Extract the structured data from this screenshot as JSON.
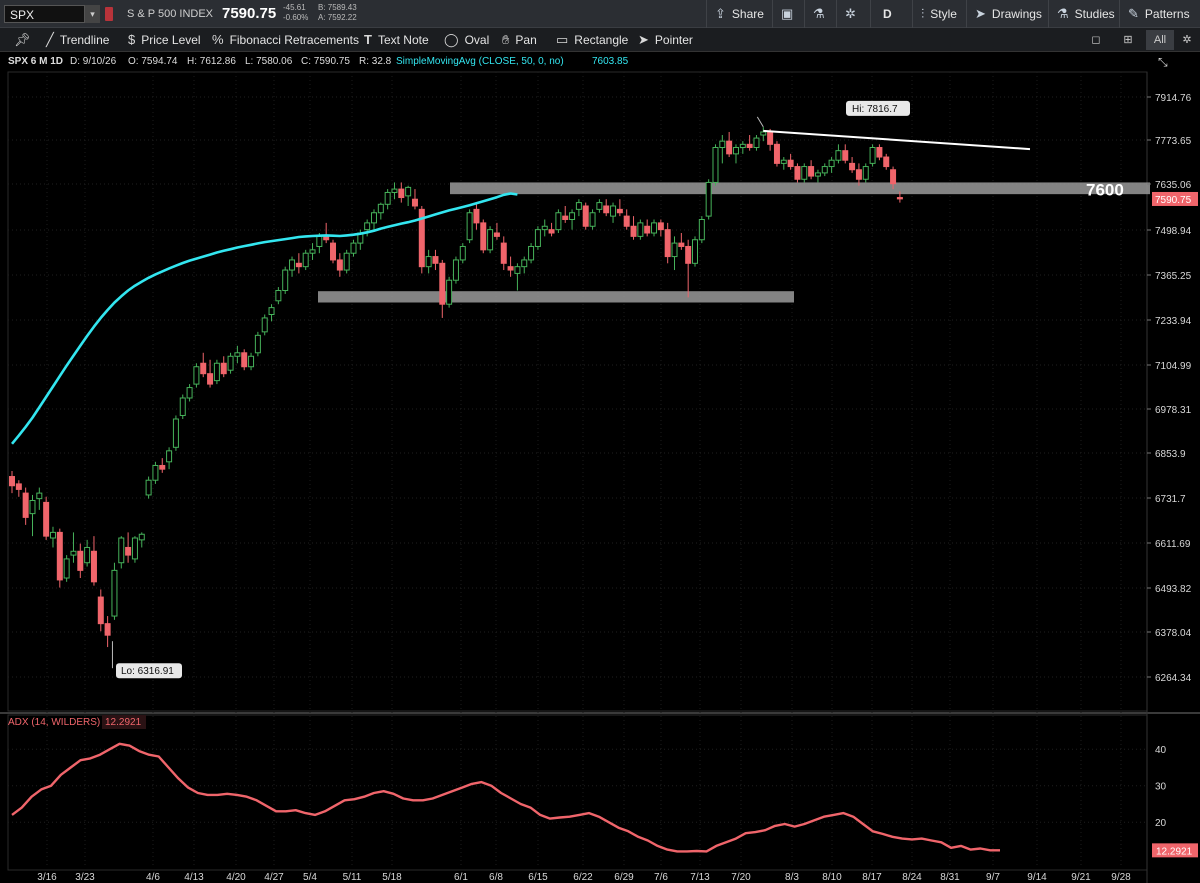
{
  "toolbar": {
    "symbol": "SPX",
    "name": "S & P 500 INDEX",
    "last": "7590.75",
    "change": "-45.61",
    "change_pct": "-0.60%",
    "bid": "B: 7589.43",
    "ask": "A: 7592.22",
    "share": "Share",
    "timeframe": "D",
    "style": "Style",
    "drawings": "Drawings",
    "studies": "Studies",
    "patterns": "Patterns"
  },
  "drawing_tools": {
    "trendline": "Trendline",
    "price_level": "Price Level",
    "fibonacci": "Fibonacci Retracements",
    "text_note": "Text Note",
    "oval": "Oval",
    "pan": "Pan",
    "rectangle": "Rectangle",
    "pointer": "Pointer",
    "view_all": "All"
  },
  "chart_header": {
    "desc": "SPX 6 M 1D",
    "date": "D: 9/10/26",
    "open": "O: 7594.74",
    "high": "H: 7612.86",
    "low": "L: 7580.06",
    "close": "C: 7590.75",
    "range": "R: 32.8",
    "study": "SimpleMovingAvg (CLOSE, 50, 0, no)",
    "study_value": "7603.85"
  },
  "colors": {
    "up": "#46b25a",
    "down": "#f0656b",
    "sma": "#33e6f0",
    "adx": "#f0656b",
    "zone": "#9a9a9a",
    "bg": "#000000"
  },
  "chart_data": [
    {
      "type": "candlestick",
      "title": "SPX 6 M 1D",
      "y_ticks": [
        "7914.76",
        "7773.65",
        "7635.06",
        "7498.94",
        "7365.25",
        "7233.94",
        "7104.99",
        "6978.31",
        "6853.9",
        "6731.7",
        "6611.69",
        "6493.82",
        "6378.04",
        "6264.34"
      ],
      "x_ticks": [
        "3/16",
        "3/23",
        "4/6",
        "4/13",
        "4/20",
        "4/27",
        "5/4",
        "5/11",
        "5/18",
        "6/1",
        "6/8",
        "6/15",
        "6/22",
        "6/29",
        "7/6",
        "7/13",
        "7/20",
        "8/3",
        "8/10",
        "8/17",
        "8/24",
        "8/31",
        "9/7",
        "9/14",
        "9/21",
        "9/28"
      ],
      "ylim": [
        6200,
        8000
      ],
      "last_price": "7590.75",
      "annotations": {
        "high": "Hi: 7816.7",
        "low": "Lo: 6316.91",
        "level_label": "7600"
      },
      "candles": [
        [
          6790,
          6805,
          6745,
          6765
        ],
        [
          6770,
          6780,
          6735,
          6755
        ],
        [
          6745,
          6760,
          6660,
          6680
        ],
        [
          6690,
          6740,
          6630,
          6725
        ],
        [
          6730,
          6760,
          6700,
          6745
        ],
        [
          6720,
          6735,
          6620,
          6630
        ],
        [
          6625,
          6655,
          6600,
          6640
        ],
        [
          6640,
          6650,
          6495,
          6515
        ],
        [
          6520,
          6580,
          6510,
          6570
        ],
        [
          6580,
          6640,
          6560,
          6590
        ],
        [
          6590,
          6610,
          6520,
          6540
        ],
        [
          6560,
          6620,
          6550,
          6600
        ],
        [
          6590,
          6630,
          6500,
          6510
        ],
        [
          6470,
          6490,
          6380,
          6400
        ],
        [
          6400,
          6420,
          6340,
          6370
        ],
        [
          6420,
          6560,
          6410,
          6540
        ],
        [
          6560,
          6630,
          6545,
          6625
        ],
        [
          6600,
          6640,
          6560,
          6580
        ],
        [
          6570,
          6630,
          6560,
          6625
        ],
        [
          6620,
          6640,
          6600,
          6635
        ],
        [
          6740,
          6790,
          6730,
          6780
        ],
        [
          6780,
          6830,
          6770,
          6820
        ],
        [
          6820,
          6840,
          6800,
          6810
        ],
        [
          6830,
          6870,
          6810,
          6860
        ],
        [
          6870,
          6960,
          6860,
          6950
        ],
        [
          6960,
          7020,
          6950,
          7010
        ],
        [
          7010,
          7050,
          7000,
          7040
        ],
        [
          7050,
          7110,
          7040,
          7100
        ],
        [
          7110,
          7140,
          7070,
          7080
        ],
        [
          7080,
          7120,
          7040,
          7050
        ],
        [
          7060,
          7120,
          7050,
          7110
        ],
        [
          7110,
          7130,
          7070,
          7080
        ],
        [
          7090,
          7140,
          7080,
          7130
        ],
        [
          7130,
          7160,
          7110,
          7140
        ],
        [
          7140,
          7150,
          7090,
          7100
        ],
        [
          7100,
          7140,
          7090,
          7130
        ],
        [
          7140,
          7200,
          7130,
          7190
        ],
        [
          7200,
          7250,
          7190,
          7240
        ],
        [
          7250,
          7280,
          7230,
          7270
        ],
        [
          7290,
          7330,
          7280,
          7320
        ],
        [
          7320,
          7390,
          7310,
          7380
        ],
        [
          7380,
          7420,
          7360,
          7410
        ],
        [
          7400,
          7430,
          7370,
          7390
        ],
        [
          7390,
          7440,
          7380,
          7430
        ],
        [
          7430,
          7460,
          7410,
          7440
        ],
        [
          7450,
          7490,
          7430,
          7480
        ],
        [
          7480,
          7520,
          7460,
          7470
        ],
        [
          7460,
          7470,
          7400,
          7410
        ],
        [
          7410,
          7430,
          7360,
          7380
        ],
        [
          7380,
          7440,
          7370,
          7430
        ],
        [
          7430,
          7470,
          7420,
          7460
        ],
        [
          7460,
          7500,
          7440,
          7490
        ],
        [
          7500,
          7530,
          7480,
          7520
        ],
        [
          7520,
          7560,
          7500,
          7550
        ],
        [
          7550,
          7580,
          7530,
          7575
        ],
        [
          7575,
          7620,
          7560,
          7610
        ],
        [
          7610,
          7640,
          7590,
          7620
        ],
        [
          7620,
          7640,
          7580,
          7595
        ],
        [
          7600,
          7630,
          7570,
          7625
        ],
        [
          7590,
          7620,
          7560,
          7570
        ],
        [
          7560,
          7570,
          7370,
          7390
        ],
        [
          7390,
          7440,
          7370,
          7420
        ],
        [
          7420,
          7440,
          7380,
          7400
        ],
        [
          7400,
          7410,
          7240,
          7280
        ],
        [
          7280,
          7360,
          7270,
          7350
        ],
        [
          7350,
          7420,
          7340,
          7410
        ],
        [
          7410,
          7460,
          7400,
          7450
        ],
        [
          7470,
          7560,
          7460,
          7550
        ],
        [
          7560,
          7580,
          7500,
          7520
        ],
        [
          7520,
          7530,
          7430,
          7440
        ],
        [
          7440,
          7510,
          7430,
          7500
        ],
        [
          7490,
          7520,
          7470,
          7480
        ],
        [
          7460,
          7480,
          7380,
          7400
        ],
        [
          7390,
          7420,
          7360,
          7380
        ],
        [
          7370,
          7400,
          7320,
          7390
        ],
        [
          7390,
          7420,
          7370,
          7410
        ],
        [
          7410,
          7460,
          7400,
          7450
        ],
        [
          7450,
          7510,
          7440,
          7500
        ],
        [
          7500,
          7530,
          7480,
          7510
        ],
        [
          7500,
          7520,
          7480,
          7490
        ],
        [
          7500,
          7560,
          7490,
          7550
        ],
        [
          7540,
          7570,
          7520,
          7530
        ],
        [
          7530,
          7560,
          7500,
          7550
        ],
        [
          7560,
          7590,
          7540,
          7580
        ],
        [
          7570,
          7580,
          7500,
          7510
        ],
        [
          7510,
          7560,
          7500,
          7550
        ],
        [
          7560,
          7590,
          7550,
          7580
        ],
        [
          7570,
          7590,
          7540,
          7550
        ],
        [
          7540,
          7580,
          7520,
          7570
        ],
        [
          7560,
          7590,
          7540,
          7550
        ],
        [
          7540,
          7560,
          7500,
          7510
        ],
        [
          7510,
          7540,
          7470,
          7480
        ],
        [
          7480,
          7530,
          7470,
          7520
        ],
        [
          7510,
          7530,
          7480,
          7490
        ],
        [
          7490,
          7530,
          7480,
          7520
        ],
        [
          7520,
          7530,
          7480,
          7500
        ],
        [
          7500,
          7520,
          7400,
          7420
        ],
        [
          7420,
          7480,
          7380,
          7460
        ],
        [
          7460,
          7490,
          7440,
          7450
        ],
        [
          7450,
          7470,
          7300,
          7400
        ],
        [
          7400,
          7480,
          7390,
          7470
        ],
        [
          7470,
          7540,
          7460,
          7530
        ],
        [
          7540,
          7650,
          7530,
          7640
        ],
        [
          7640,
          7760,
          7630,
          7750
        ],
        [
          7750,
          7790,
          7700,
          7770
        ],
        [
          7770,
          7800,
          7720,
          7730
        ],
        [
          7730,
          7760,
          7700,
          7750
        ],
        [
          7750,
          7770,
          7730,
          7760
        ],
        [
          7760,
          7790,
          7740,
          7750
        ],
        [
          7750,
          7790,
          7740,
          7780
        ],
        [
          7790,
          7816,
          7770,
          7800
        ],
        [
          7800,
          7810,
          7740,
          7760
        ],
        [
          7760,
          7770,
          7690,
          7700
        ],
        [
          7700,
          7720,
          7680,
          7710
        ],
        [
          7710,
          7730,
          7680,
          7690
        ],
        [
          7690,
          7700,
          7640,
          7650
        ],
        [
          7650,
          7700,
          7640,
          7690
        ],
        [
          7690,
          7710,
          7650,
          7660
        ],
        [
          7660,
          7680,
          7640,
          7670
        ],
        [
          7670,
          7700,
          7660,
          7690
        ],
        [
          7690,
          7720,
          7670,
          7710
        ],
        [
          7710,
          7760,
          7700,
          7740
        ],
        [
          7740,
          7760,
          7700,
          7710
        ],
        [
          7700,
          7720,
          7670,
          7680
        ],
        [
          7680,
          7700,
          7630,
          7650
        ],
        [
          7650,
          7700,
          7640,
          7690
        ],
        [
          7700,
          7760,
          7690,
          7750
        ],
        [
          7750,
          7760,
          7710,
          7720
        ],
        [
          7720,
          7730,
          7680,
          7690
        ],
        [
          7680,
          7690,
          7620,
          7636
        ],
        [
          7595,
          7613,
          7580,
          7591
        ]
      ],
      "sma": {
        "name": "SimpleMovingAvg (CLOSE, 50, 0, no)",
        "values": [
          6880,
          6877,
          6874,
          6871,
          6868,
          6862,
          6855,
          6847,
          6838,
          6828,
          6815,
          6800,
          6786,
          6776,
          6770,
          6766,
          6764,
          6763,
          6765,
          6768,
          6773,
          6779,
          6786,
          6794,
          6804,
          6815,
          6828,
          6843,
          6860,
          6880,
          6903,
          6928,
          6954,
          6983,
          7013,
          7043,
          7073,
          7103,
          7132,
          7160,
          7188,
          7215,
          7240,
          7263,
          7285,
          7303,
          7320,
          7334,
          7346,
          7357,
          7367,
          7376,
          7385,
          7393,
          7401,
          7408,
          7414,
          7420,
          7426,
          7432,
          7437,
          7442,
          7447,
          7451,
          7455,
          7459,
          7463,
          7466,
          7469,
          7472,
          7475,
          7478,
          7480,
          7481,
          7482,
          7483,
          7482,
          7481,
          7483,
          7485,
          7488,
          7492,
          7497,
          7503,
          7508,
          7513,
          7518,
          7522,
          7527,
          7533,
          7539,
          7545,
          7551,
          7557,
          7562,
          7567,
          7572,
          7578,
          7584,
          7590,
          7596,
          7603,
          7607,
          7604
        ],
        "offset": 29
      }
    },
    {
      "type": "line",
      "title": "ADX (14, WILDERS)",
      "current": "12.2921",
      "y_ticks": [
        "40",
        "30",
        "20"
      ],
      "ylim": [
        8,
        45
      ],
      "series": [
        {
          "name": "ADX (14, WILDERS)",
          "values": [
            22,
            24,
            27,
            29,
            30,
            33,
            35,
            37,
            37.5,
            38.5,
            40,
            41.5,
            41,
            39.5,
            38.5,
            38,
            35,
            32,
            29.5,
            28,
            27.5,
            27.5,
            27.8,
            27.5,
            27,
            26,
            24.5,
            23,
            23,
            23.3,
            22.5,
            22,
            23,
            24.5,
            26,
            26.3,
            27,
            28,
            28.5,
            27.8,
            26.5,
            26,
            26,
            26.5,
            27.5,
            28.5,
            29.5,
            30.5,
            31,
            30,
            28,
            26.5,
            25,
            24,
            22,
            21,
            21.3,
            21.5,
            22,
            22.5,
            21.5,
            20,
            18.5,
            17.5,
            16,
            15,
            13.5,
            12.5,
            12,
            12,
            12.1,
            12,
            13.5,
            14.5,
            15.5,
            17,
            17.3,
            17.8,
            19,
            19.5,
            18.8,
            19.5,
            20.5,
            21.5,
            22,
            22.5,
            21.5,
            19.5,
            17.5,
            16.8,
            16,
            15.5,
            15.3,
            15.5,
            15,
            14.5,
            13,
            13.5,
            12.5,
            12.8,
            12.3,
            12.29
          ]
        }
      ]
    }
  ]
}
